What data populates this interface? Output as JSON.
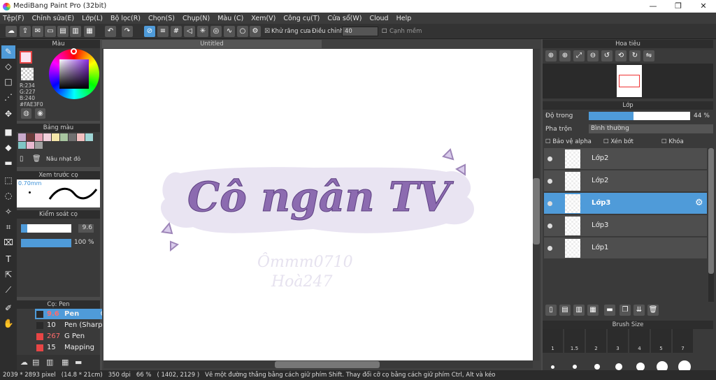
{
  "window": {
    "title": "MediBang Paint Pro (32bit)",
    "min": "—",
    "max": "❐",
    "close": "✕"
  },
  "menu": [
    "Tệp(F)",
    "Chỉnh sửa(E)",
    "Lớp(L)",
    "Bộ lọc(R)",
    "Chọn(S)",
    "Chụp(N)",
    "Màu (C)",
    "Xem(V)",
    "Công cụ(T)",
    "Cửa sổ(W)",
    "Cloud",
    "Help"
  ],
  "toolbar": {
    "antialias_label": "Khử răng cưa",
    "correction_label": "Điều chỉnh",
    "correction_value": "40",
    "smooth_label": "Cạnh mềm"
  },
  "color_panel": {
    "title": "Màu",
    "r": "R:234",
    "g": "G:227",
    "b": "B:240",
    "hex": "#FAE3F0"
  },
  "palette_panel": {
    "title": "Bảng màu",
    "item": "Nâu nhạt đỏ"
  },
  "preview_panel": {
    "title": "Xem trước cọ",
    "size": "0.70mm"
  },
  "brush_control": {
    "title": "Kiểm soát cọ",
    "size": "9.6",
    "opacity": "100 %"
  },
  "brush_panel": {
    "title": "Cọ: Pen",
    "items": [
      {
        "size": "9.6",
        "name": "Pen",
        "color": "#2a2a2a"
      },
      {
        "size": "10",
        "name": "Pen (Sharp)",
        "color": "#2a2a2a"
      },
      {
        "size": "267",
        "name": "G Pen",
        "color": "#e84545"
      },
      {
        "size": "15",
        "name": "Mapping Pen",
        "color": "#e84545"
      }
    ]
  },
  "document": {
    "tab": "Untitled",
    "art_title": "Cô ngân TV",
    "watermark1": "Ômmm0710",
    "watermark2": "Hoà247"
  },
  "navigator": {
    "title": "Hoa tiêu"
  },
  "layers_panel": {
    "title": "Lớp",
    "opacity_label": "Độ trong",
    "opacity_value": "44 %",
    "opacity_fraction": 0.44,
    "blend_label": "Pha trộn",
    "blend_value": "Bình thường",
    "protect_alpha": "Bảo vệ alpha",
    "clipping": "Xén bớt",
    "lock": "Khóa",
    "layers": [
      "Lớp2",
      "Lớp2",
      "Lớp3",
      "Lớp3",
      "Lớp1"
    ]
  },
  "brush_size": {
    "title": "Brush Size",
    "sizes": [
      "1",
      "1.5",
      "2",
      "3",
      "4",
      "5",
      "7"
    ]
  },
  "status": {
    "dims": "2039 * 2893 pixel",
    "mm": "(14.8 * 21cm)",
    "dpi": "350 dpi",
    "zoom": "66 %",
    "coords": "( 1402, 2129 )",
    "hint": "Vẽ một đường thẳng bằng cách giữ phím Shift. Thay đổi cỡ cọ bằng cách giữ phím Ctrl, Alt và kéo"
  }
}
